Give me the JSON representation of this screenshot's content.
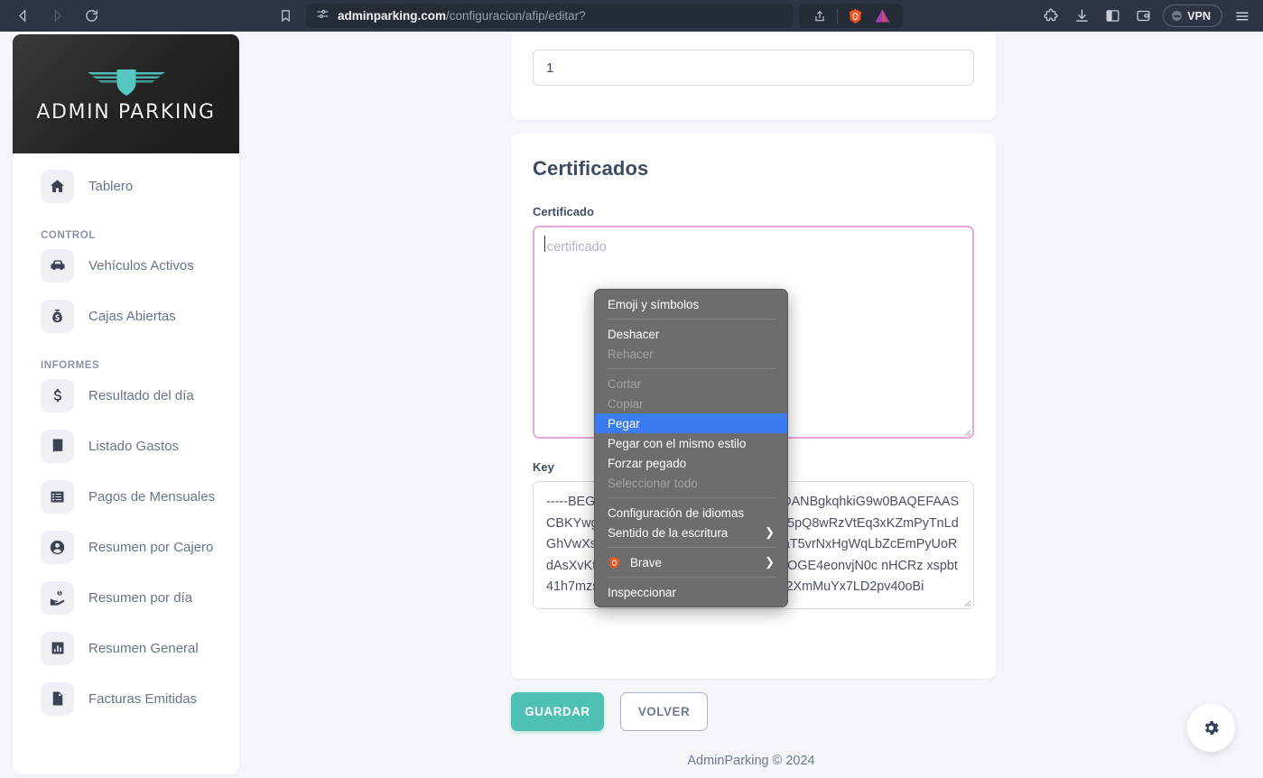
{
  "browser": {
    "back_icon": "back-arrow-icon",
    "forward_icon": "forward-arrow-icon",
    "reload_icon": "reload-icon",
    "bookmark_icon": "bookmark-icon",
    "url_domain": "adminparking.com",
    "url_path": "/configuracion/afip/editar?",
    "site_settings_icon": "tune-sliders-icon",
    "share_icon": "share-icon",
    "brave_shields_icon": "brave-lion-icon",
    "brave_rewards_icon": "brave-triangle-icon",
    "extensions_icon": "puzzle-extensions-icon",
    "downloads_icon": "download-icon",
    "sidebar_icon": "sidebar-panel-icon",
    "wallet_icon": "wallet-icon",
    "vpn_label": "VPN",
    "menu_icon": "hamburger-menu-icon"
  },
  "sidebar": {
    "brand_name": "ADMIN PARKING",
    "brand_logo_icon": "winged-shield-logo",
    "groups": [
      {
        "title": null,
        "items": [
          {
            "label": "Tablero",
            "icon": "home-icon"
          }
        ]
      },
      {
        "title": "CONTROL",
        "items": [
          {
            "label": "Vehículos Activos",
            "icon": "car-icon"
          },
          {
            "label": "Cajas Abiertas",
            "icon": "money-bag-icon"
          }
        ]
      },
      {
        "title": "INFORMES",
        "items": [
          {
            "label": "Resultado del día",
            "icon": "dollar-sign-icon"
          },
          {
            "label": "Listado Gastos",
            "icon": "receipt-icon"
          },
          {
            "label": "Pagos de Mensuales",
            "icon": "list-box-icon"
          },
          {
            "label": "Resumen por Cajero",
            "icon": "user-circle-icon"
          },
          {
            "label": "Resumen por día",
            "icon": "hand-coins-icon"
          },
          {
            "label": "Resumen General",
            "icon": "bar-chart-icon"
          },
          {
            "label": "Facturas Emitidas",
            "icon": "invoice-document-icon"
          }
        ]
      }
    ]
  },
  "main": {
    "top_card": {
      "input_value": "1"
    },
    "cert_card": {
      "title": "Certificados",
      "certificado_label": "Certificado",
      "certificado_value": "",
      "certificado_placeholder": "certificado",
      "key_label": "Key",
      "key_value": "-----BEGIN PRIVATE KEY-----\nMIIEvAIBADANBgkqhkiG9w0BAQEFAASCBKYwggSiAgEAAoIBAQCqnBKl\n7miJSs5pQ8wRzVtEq3xKZmPyTnLdGhVwXsA0bCjEfRuNoYqP2LmKdTvB\nJ7aT5vrNxHgWqLbZcEmPyUoRdAsXvKtJnMfGhBwTcLQrSpvnoWjPieOIAOGE4eonvjN0c\nnHCRz\nxspbt41h7mzsuMlipkMnxgNeo6YNMn0/dIzsicv2XmMuYx7LD2pv40oBi"
    },
    "buttons": {
      "save": "GUARDAR",
      "back": "VOLVER"
    },
    "fab_icon": "gear-icon",
    "footer": "AdminParking © 2024"
  },
  "context_menu": {
    "items": [
      {
        "label": "Emoji y símbolos",
        "state": "enabled",
        "submenu": false
      },
      {
        "label": "__sep__",
        "state": "separator",
        "submenu": false
      },
      {
        "label": "Deshacer",
        "state": "enabled",
        "submenu": false
      },
      {
        "label": "Rehacer",
        "state": "disabled",
        "submenu": false
      },
      {
        "label": "__sep__",
        "state": "separator",
        "submenu": false
      },
      {
        "label": "Cortar",
        "state": "disabled",
        "submenu": false
      },
      {
        "label": "Copiar",
        "state": "disabled",
        "submenu": false
      },
      {
        "label": "Pegar",
        "state": "selected",
        "submenu": false
      },
      {
        "label": "Pegar con el mismo estilo",
        "state": "enabled",
        "submenu": false
      },
      {
        "label": "Forzar pegado",
        "state": "enabled",
        "submenu": false
      },
      {
        "label": "Seleccionar todo",
        "state": "disabled",
        "submenu": false
      },
      {
        "label": "__sep__",
        "state": "separator",
        "submenu": false
      },
      {
        "label": "Configuración de idiomas",
        "state": "enabled",
        "submenu": false
      },
      {
        "label": "Sentido de la escritura",
        "state": "enabled",
        "submenu": true
      },
      {
        "label": "__sep__",
        "state": "separator",
        "submenu": false
      },
      {
        "label": "Brave",
        "state": "enabled",
        "submenu": true,
        "icon": "brave-lion-icon"
      },
      {
        "label": "__sep__",
        "state": "separator",
        "submenu": false
      },
      {
        "label": "Inspeccionar",
        "state": "enabled",
        "submenu": false
      }
    ]
  },
  "colors": {
    "accent_teal": "#4ec1b3",
    "focus_pink": "#e8a6d8",
    "menu_highlight": "#3a7bf0",
    "chrome_bg": "#2e3443",
    "page_bg": "#f5f6f9",
    "heading": "#3d4a63"
  }
}
